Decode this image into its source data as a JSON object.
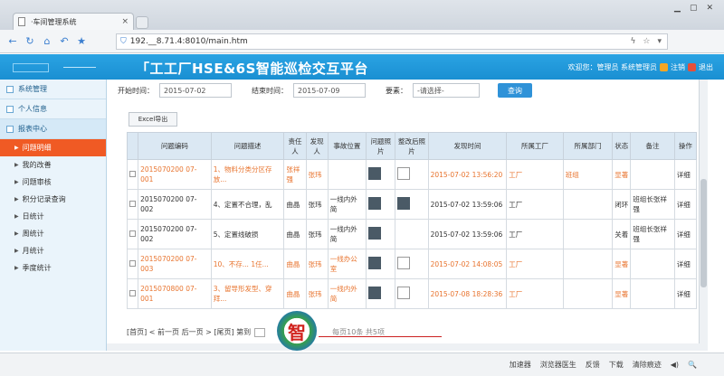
{
  "browser": {
    "tab_title": "·车间管理系统",
    "url": "192.__8.71.4:8010/main.htm"
  },
  "app": {
    "title": "「工工厂HSE&6S智能巡检交互平台",
    "welcome": "欢迎您：管理员 系统管理员",
    "logout": "注销",
    "exit": "退出"
  },
  "sidebar": {
    "sections": [
      "系统管理",
      "个人信息",
      "报表中心"
    ],
    "items": [
      "问题明细",
      "我的改善",
      "问题审核",
      "积分记录查询",
      "日统计",
      "周统计",
      "月统计",
      "季度统计"
    ]
  },
  "filter": {
    "start_label": "开始时间：",
    "start_value": "2015-07-02",
    "end_label": "结束时间：",
    "end_value": "2015-07-09",
    "elem_label": "要素：",
    "elem_value": "-请选择-",
    "query": "查询"
  },
  "excel_label": "Excel导出",
  "table": {
    "headers": [
      "",
      "问题编码",
      "问题描述",
      "责任人",
      "发现人",
      "事故位置",
      "问题照片",
      "整改后照片",
      "发现时间",
      "所属工厂",
      "所属部门",
      "状态",
      "备注",
      "操作"
    ],
    "rows": [
      {
        "code": "2015070200 07-001",
        "desc": "1、物料分类分区存放...",
        "resp": "张祥强",
        "finder": "张玮",
        "loc": "",
        "time": "2015-07-02 13:56:20",
        "factory": "工厂",
        "dept": "班组",
        "status": "显著",
        "note": "",
        "op": "详细"
      },
      {
        "code": "2015070200 07-002",
        "desc": "4、定置不合理，乱",
        "resp": "曲晶",
        "finder": "张玮",
        "loc": "一线内外简",
        "time": "2015-07-02 13:59:06",
        "factory": "工厂",
        "dept": "",
        "status": "闭环",
        "note": "班组长张祥强",
        "op": "详细"
      },
      {
        "code": "2015070200 07-002",
        "desc": "5、定置线破损",
        "resp": "曲晶",
        "finder": "张玮",
        "loc": "一线内外简",
        "time": "2015-07-02 13:59:06",
        "factory": "工厂",
        "dept": "",
        "status": "关着",
        "note": "班组长张祥强",
        "op": "详细"
      },
      {
        "code": "2015070200 07-003",
        "desc": "10、不存... 1任...",
        "resp": "曲晶",
        "finder": "张玮",
        "loc": "一线办公室",
        "time": "2015-07-02 14:08:05",
        "factory": "工厂",
        "dept": "",
        "status": "显著",
        "note": "",
        "op": "详细"
      },
      {
        "code": "2015070800 07-001",
        "desc": "3、留导形发型、穿拜...",
        "resp": "曲晶",
        "finder": "张玮",
        "loc": "一线内外简",
        "time": "2015-07-08 18:28:36",
        "factory": "工厂",
        "dept": "",
        "status": "显著",
        "note": "",
        "op": "详细"
      }
    ]
  },
  "pager": {
    "text": "[首页] < 前一页 后一页 > [尾页] 第到",
    "tail": "每页10条 共5项"
  },
  "watermark": "智",
  "status_bar": [
    "加速器",
    "浏览器医生",
    "反馈",
    "下载",
    "清除痕迹"
  ]
}
